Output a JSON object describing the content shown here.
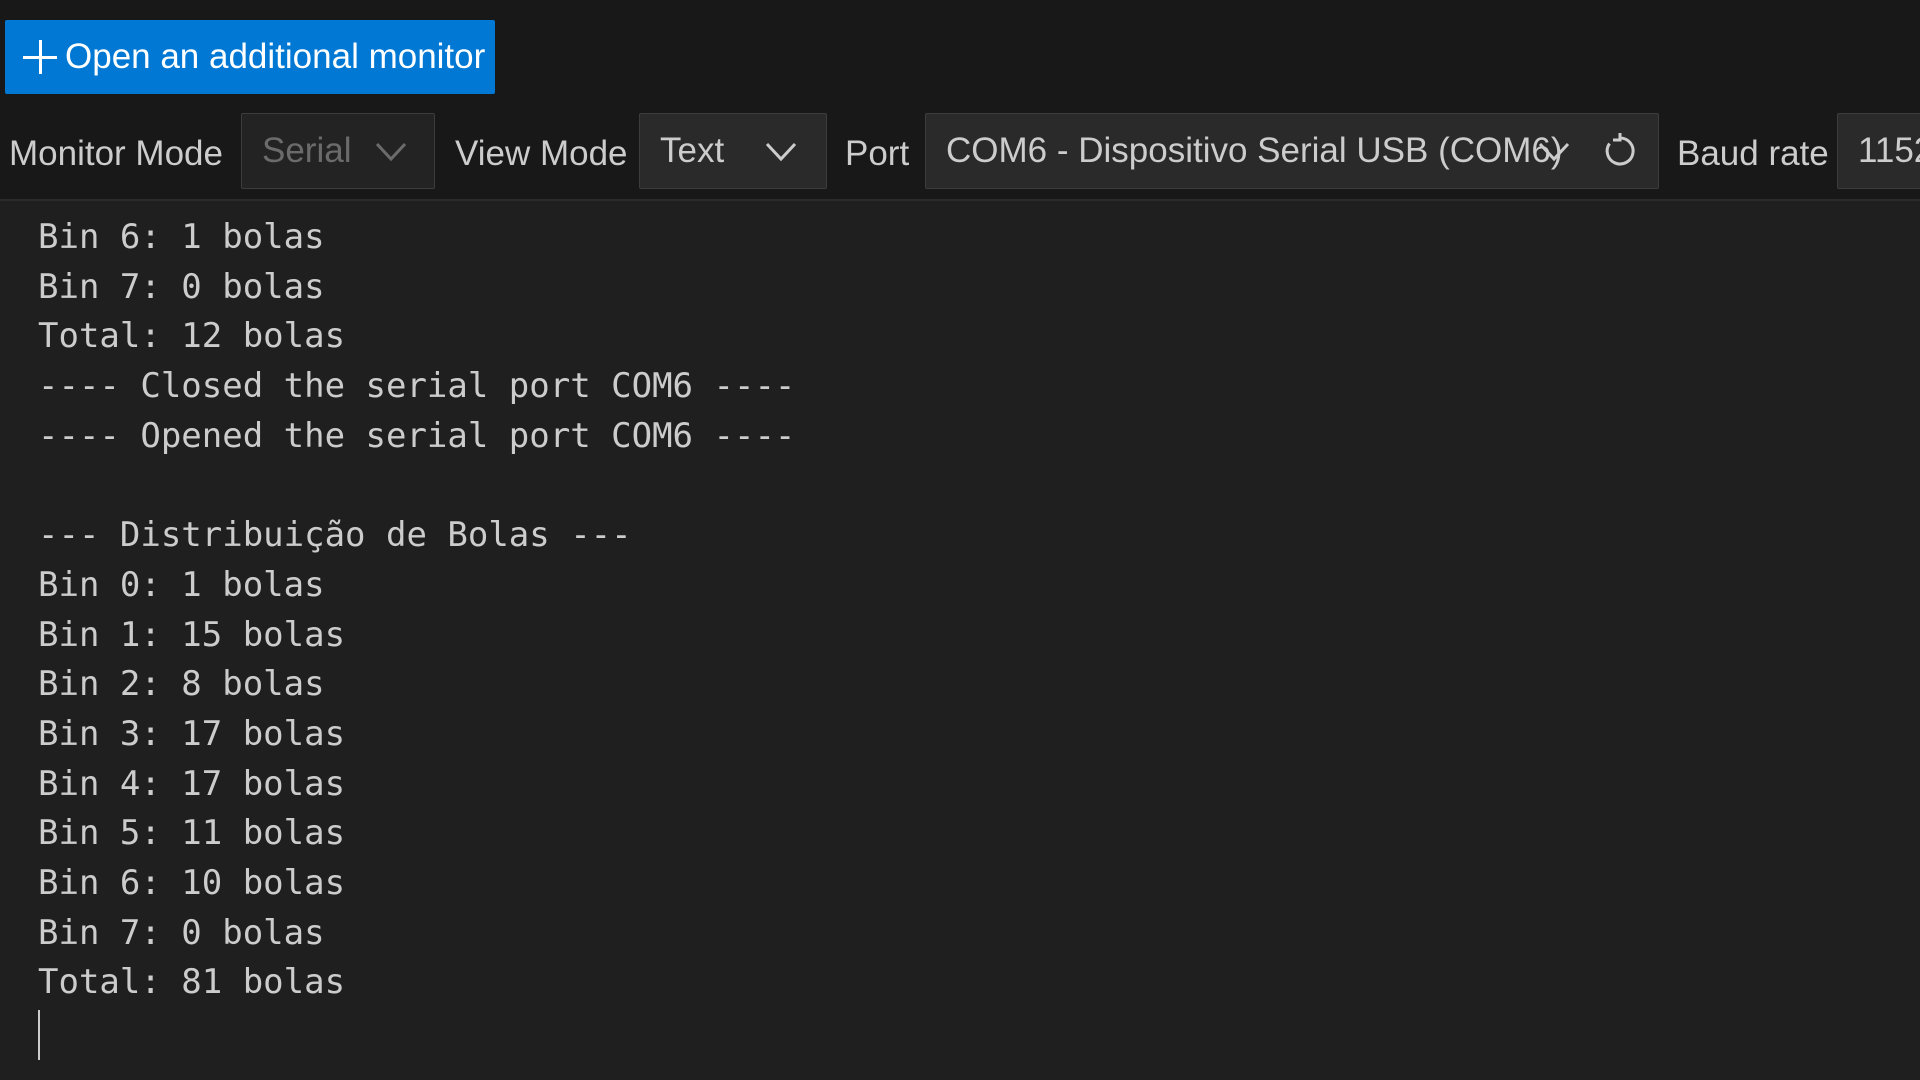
{
  "header": {
    "open_monitor_label": "Open an additional monitor"
  },
  "toolbar": {
    "monitor_mode_label": "Monitor Mode",
    "monitor_mode_value": "Serial",
    "view_mode_label": "View Mode",
    "view_mode_value": "Text",
    "port_label": "Port",
    "port_value": "COM6 - Dispositivo Serial USB (COM6)",
    "baud_rate_label": "Baud rate",
    "baud_rate_value": "1152"
  },
  "output": {
    "lines": [
      "Bin 6: 1 bolas",
      "Bin 7: 0 bolas",
      "Total: 12 bolas",
      "---- Closed the serial port COM6 ----",
      "---- Opened the serial port COM6 ----",
      "",
      "--- Distribuição de Bolas ---",
      "Bin 0: 1 bolas",
      "Bin 1: 15 bolas",
      "Bin 2: 8 bolas",
      "Bin 3: 17 bolas",
      "Bin 4: 17 bolas",
      "Bin 5: 11 bolas",
      "Bin 6: 10 bolas",
      "Bin 7: 0 bolas",
      "Total: 81 bolas"
    ]
  },
  "icons": {
    "plus": "plus-icon",
    "chevron": "chevron-down-icon",
    "refresh": "refresh-icon"
  },
  "colors": {
    "accent": "#0078d4",
    "background": "#1f1f1f",
    "toolbar_bg": "#181818",
    "text": "#cccccc"
  }
}
